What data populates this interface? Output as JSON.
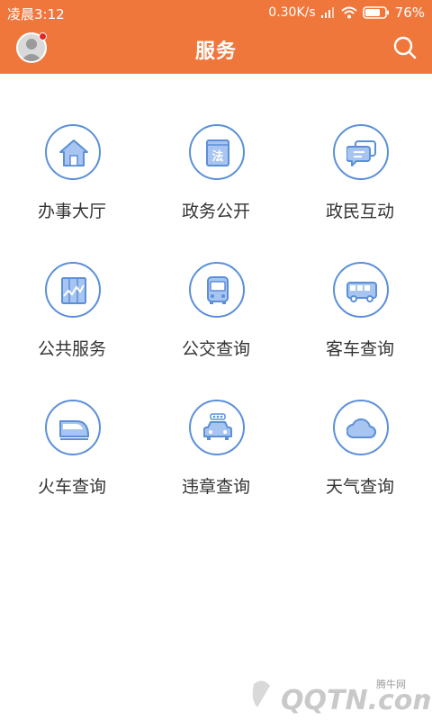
{
  "status_bar": {
    "time": "凌晨3:12",
    "speed": "0.30K/s",
    "battery": "76%"
  },
  "header": {
    "title": "服务",
    "avatar_icon": "user-avatar-icon",
    "search_icon": "search-icon"
  },
  "colors": {
    "brand": "#F0773C",
    "icon_blue": "#5B8FD8",
    "icon_fill": "#A7C5F0"
  },
  "services": [
    {
      "label": "办事大厅",
      "icon": "house-icon"
    },
    {
      "label": "政务公开",
      "icon": "law-book-icon"
    },
    {
      "label": "政民互动",
      "icon": "chat-bubble-icon"
    },
    {
      "label": "公共服务",
      "icon": "chart-board-icon"
    },
    {
      "label": "公交查询",
      "icon": "bus-icon"
    },
    {
      "label": "客车查询",
      "icon": "coach-icon"
    },
    {
      "label": "火车查询",
      "icon": "train-icon"
    },
    {
      "label": "违章查询",
      "icon": "car-icon"
    },
    {
      "label": "天气查询",
      "icon": "cloud-icon"
    }
  ],
  "watermark": {
    "small_text": "腾牛网",
    "large_text": "QQTN.com"
  }
}
